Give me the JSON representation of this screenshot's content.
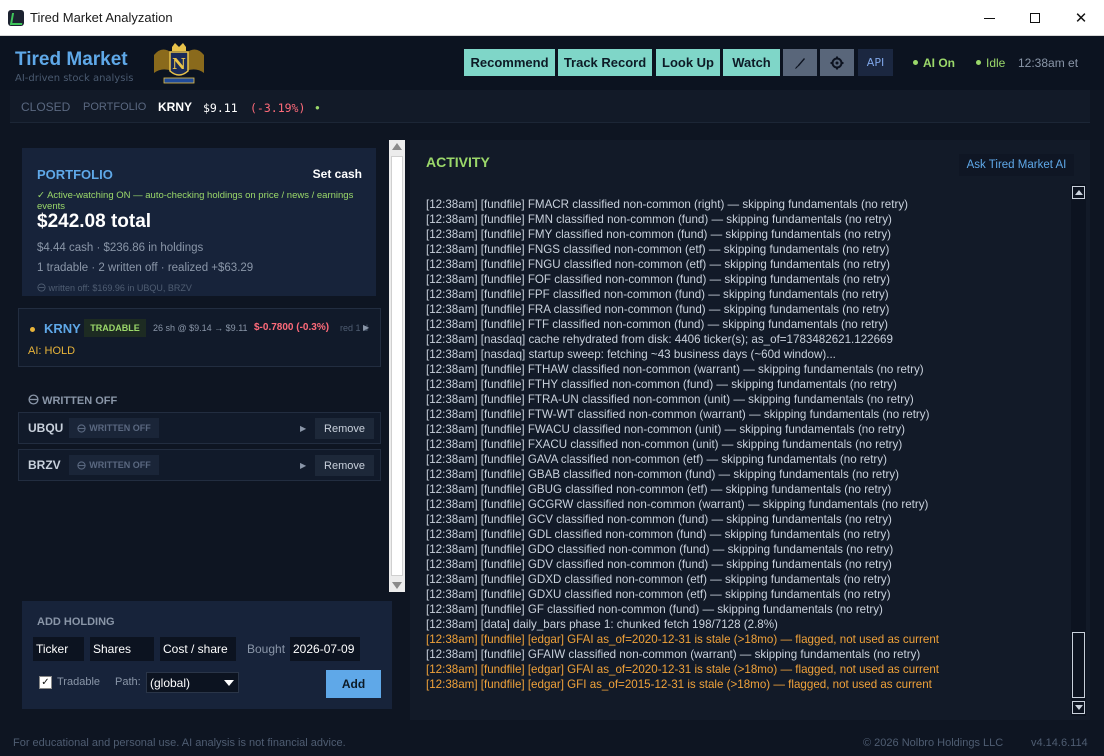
{
  "window": {
    "title": "Tired Market Analyzation",
    "controls": {
      "minimize": "",
      "maximize": "",
      "close": "✕"
    }
  },
  "brand": {
    "title": "Tired Market",
    "subtitle": "AI-driven stock analysis",
    "logo_text": "N"
  },
  "nav": {
    "buttons": [
      "Recommend",
      "Track Record",
      "Look Up",
      "Watch"
    ],
    "api_label": "API",
    "ai_status": "AI On",
    "idle_status": "Idle",
    "time": "12:38am et"
  },
  "tickerbar": {
    "market_state": "CLOSED",
    "portfolio_label": "PORTFOLIO",
    "ticker": "KRNY",
    "price": "$9.11",
    "change": "(-3.19%)",
    "dot": "●"
  },
  "portfolio": {
    "heading": "PORTFOLIO",
    "set_cash": "Set cash",
    "watch_status": "✓ Active-watching ON — auto-checking holdings on price / news / earnings events",
    "total": "$242.08 total",
    "cash_line": "$4.44 cash  ·  $236.86 in holdings",
    "trade_line": "1 tradable  ·  2 written off  ·  realized +$63.29",
    "written_off_line": "written off: $169.96 in UBQU, BRZV"
  },
  "holding": {
    "ticker": "KRNY",
    "badge": "TRADABLE",
    "position": "26 sh @ $9.14 → $9.11",
    "change": "$-0.7800 (-0.3%)",
    "realized": "red 1 da",
    "arrow": "▶",
    "ai": "AI: HOLD"
  },
  "written_off": {
    "heading": "WRITTEN OFF",
    "rows": [
      {
        "ticker": "UBQU",
        "badge": "WRITTEN OFF",
        "arrow": "▶",
        "remove": "Remove"
      },
      {
        "ticker": "BRZV",
        "badge": "WRITTEN OFF",
        "arrow": "▶",
        "remove": "Remove"
      }
    ]
  },
  "add_holding": {
    "heading": "ADD HOLDING",
    "ticker_placeholder": "Ticker",
    "shares_placeholder": "Shares",
    "cost_placeholder": "Cost / share",
    "bought_label": "Bought",
    "bought_value": "2026-07-09",
    "tradable_label": "Tradable",
    "tradable_check": "✓",
    "path_label": "Path:",
    "path_value": "(global)",
    "add_button": "Add"
  },
  "activity": {
    "heading": "ACTIVITY",
    "ask_button": "Ask Tired Market AI",
    "lines": [
      {
        "text": "[12:38am] [fundfile] FMACR classified non-common (right) — skipping fundamentals (no retry)",
        "warn": false
      },
      {
        "text": "[12:38am] [fundfile] FMN classified non-common (fund) — skipping fundamentals (no retry)",
        "warn": false
      },
      {
        "text": "[12:38am] [fundfile] FMY classified non-common (fund) — skipping fundamentals (no retry)",
        "warn": false
      },
      {
        "text": "[12:38am] [fundfile] FNGS classified non-common (etf) — skipping fundamentals (no retry)",
        "warn": false
      },
      {
        "text": "[12:38am] [fundfile] FNGU classified non-common (etf) — skipping fundamentals (no retry)",
        "warn": false
      },
      {
        "text": "[12:38am] [fundfile] FOF classified non-common (fund) — skipping fundamentals (no retry)",
        "warn": false
      },
      {
        "text": "[12:38am] [fundfile] FPF classified non-common (fund) — skipping fundamentals (no retry)",
        "warn": false
      },
      {
        "text": "[12:38am] [fundfile] FRA classified non-common (fund) — skipping fundamentals (no retry)",
        "warn": false
      },
      {
        "text": "[12:38am] [fundfile] FTF classified non-common (fund) — skipping fundamentals (no retry)",
        "warn": false
      },
      {
        "text": "[12:38am] [nasdaq] cache rehydrated from disk: 4406 ticker(s); as_of=1783482621.122669",
        "warn": false
      },
      {
        "text": "[12:38am] [nasdaq] startup sweep: fetching ~43 business days (~60d window)...",
        "warn": false
      },
      {
        "text": "[12:38am] [fundfile] FTHAW classified non-common (warrant) — skipping fundamentals (no retry)",
        "warn": false
      },
      {
        "text": "[12:38am] [fundfile] FTHY classified non-common (fund) — skipping fundamentals (no retry)",
        "warn": false
      },
      {
        "text": "[12:38am] [fundfile] FTRA-UN classified non-common (unit) — skipping fundamentals (no retry)",
        "warn": false
      },
      {
        "text": "[12:38am] [fundfile] FTW-WT classified non-common (warrant) — skipping fundamentals (no retry)",
        "warn": false
      },
      {
        "text": "[12:38am] [fundfile] FWACU classified non-common (unit) — skipping fundamentals (no retry)",
        "warn": false
      },
      {
        "text": "[12:38am] [fundfile] FXACU classified non-common (unit) — skipping fundamentals (no retry)",
        "warn": false
      },
      {
        "text": "[12:38am] [fundfile] GAVA classified non-common (etf) — skipping fundamentals (no retry)",
        "warn": false
      },
      {
        "text": "[12:38am] [fundfile] GBAB classified non-common (fund) — skipping fundamentals (no retry)",
        "warn": false
      },
      {
        "text": "[12:38am] [fundfile] GBUG classified non-common (etf) — skipping fundamentals (no retry)",
        "warn": false
      },
      {
        "text": "[12:38am] [fundfile] GCGRW classified non-common (warrant) — skipping fundamentals (no retry)",
        "warn": false
      },
      {
        "text": "[12:38am] [fundfile] GCV classified non-common (fund) — skipping fundamentals (no retry)",
        "warn": false
      },
      {
        "text": "[12:38am] [fundfile] GDL classified non-common (fund) — skipping fundamentals (no retry)",
        "warn": false
      },
      {
        "text": "[12:38am] [fundfile] GDO classified non-common (fund) — skipping fundamentals (no retry)",
        "warn": false
      },
      {
        "text": "[12:38am] [fundfile] GDV classified non-common (fund) — skipping fundamentals (no retry)",
        "warn": false
      },
      {
        "text": "[12:38am] [fundfile] GDXD classified non-common (etf) — skipping fundamentals (no retry)",
        "warn": false
      },
      {
        "text": "[12:38am] [fundfile] GDXU classified non-common (etf) — skipping fundamentals (no retry)",
        "warn": false
      },
      {
        "text": "[12:38am] [fundfile] GF classified non-common (fund) — skipping fundamentals (no retry)",
        "warn": false
      },
      {
        "text": "[12:38am] [data] daily_bars phase 1: chunked fetch 198/7128 (2.8%)",
        "warn": false
      },
      {
        "text": "[12:38am] [fundfile] [edgar] GFAI as_of=2020-12-31 is stale (>18mo) — flagged, not used as current",
        "warn": true
      },
      {
        "text": "[12:38am] [fundfile] GFAIW classified non-common (warrant) — skipping fundamentals (no retry)",
        "warn": false
      },
      {
        "text": "[12:38am] [fundfile] [edgar] GFAI as_of=2020-12-31 is stale (>18mo) — flagged, not used as current",
        "warn": true
      },
      {
        "text": "[12:38am] [fundfile] [edgar] GFI as_of=2015-12-31 is stale (>18mo) — flagged, not used as current",
        "warn": true
      }
    ]
  },
  "footer": {
    "disclaimer": "For educational and personal use. AI analysis is not financial advice.",
    "copyright": "© 2026 Nolbro Holdings LLC",
    "version": "v4.14.6.114"
  },
  "colors": {
    "accent_blue": "#5fa8e8",
    "accent_teal": "#7fd6c8",
    "positive_green": "#9bd86a",
    "negative_red": "#ff6b7a",
    "warning_orange": "#f0a23a",
    "background": "#0e1522"
  },
  "icons": {
    "app": "app-chart-icon",
    "brush": "brush-icon",
    "settings": "gear-icon",
    "written_off": "skull-icon"
  }
}
